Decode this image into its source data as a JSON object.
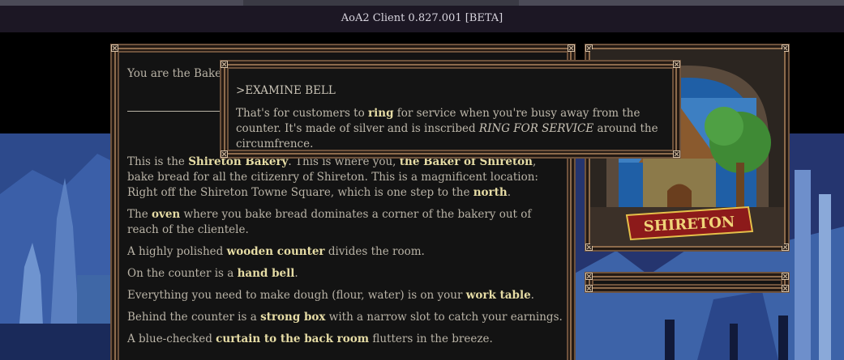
{
  "window": {
    "title": "AoA2 Client 0.827.001 [BETA]"
  },
  "main": {
    "intro": "You are the Baker of Shireton.",
    "paragraphs": [
      {
        "parts": [
          {
            "t": "This is the "
          },
          {
            "b": "Shireton Bakery"
          },
          {
            "t": ". This is where you, "
          },
          {
            "b": "the Baker of Shireton"
          },
          {
            "t": ", bake bread for all the citizenry of Shireton. This is a magnificent location: Right off the Shireton Towne Square, which is one step to the "
          },
          {
            "b": "north"
          },
          {
            "t": "."
          }
        ]
      },
      {
        "parts": [
          {
            "t": "The "
          },
          {
            "b": "oven"
          },
          {
            "t": " where you bake bread dominates a corner of the bakery out of reach of the clientele."
          }
        ]
      },
      {
        "parts": [
          {
            "t": "A highly polished "
          },
          {
            "b": "wooden counter"
          },
          {
            "t": " divides the room."
          }
        ]
      },
      {
        "parts": [
          {
            "t": "On the counter is a "
          },
          {
            "b": "hand bell"
          },
          {
            "t": "."
          }
        ]
      },
      {
        "parts": [
          {
            "t": "Everything you need to make dough (flour, water) is on your "
          },
          {
            "b": "work table"
          },
          {
            "t": "."
          }
        ]
      },
      {
        "parts": [
          {
            "t": "Behind the counter is a "
          },
          {
            "b": "strong box"
          },
          {
            "t": " with a narrow slot to catch your earnings."
          }
        ]
      },
      {
        "parts": [
          {
            "t": "A blue-checked "
          },
          {
            "b": "curtain to the back room"
          },
          {
            "t": " flutters in the breeze."
          }
        ]
      }
    ]
  },
  "popup": {
    "command": ">EXAMINE BELL",
    "body_parts": [
      {
        "t": "That's for customers to "
      },
      {
        "b": "ring"
      },
      {
        "t": " for service when you're busy away from the counter. It's made of silver and is inscribed "
      },
      {
        "i": "RING FOR SERVICE"
      },
      {
        "t": " around the circumfrence."
      }
    ]
  },
  "location_image": {
    "banner_text": "SHIRETON"
  },
  "colors": {
    "highlight": "#e6dca5",
    "frame": "#8d6b4c",
    "panel_bg": "#131313",
    "banner_red": "#8c1a1a"
  }
}
